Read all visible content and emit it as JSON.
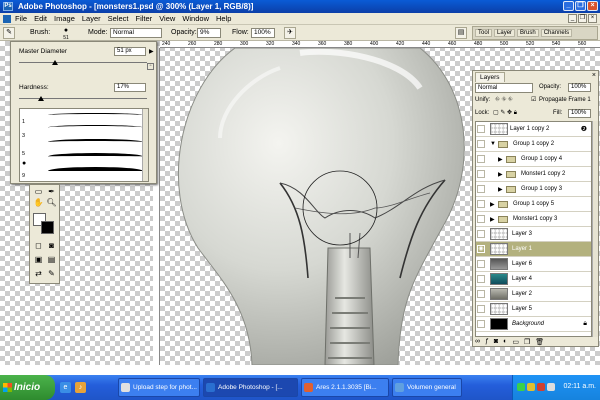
{
  "app": {
    "title": "Adobe Photoshop - [monsters1.psd @ 300% (Layer 1, RGB/8)]"
  },
  "menu": [
    "File",
    "Edit",
    "Image",
    "Layer",
    "Select",
    "Filter",
    "View",
    "Window",
    "Help"
  ],
  "options": {
    "brush_label": "Brush:",
    "brush_size": "51",
    "mode_label": "Mode:",
    "mode_value": "Normal",
    "opacity_label": "Opacity:",
    "opacity_value": "9%",
    "flow_label": "Flow:",
    "flow_value": "100%"
  },
  "wells": [
    "Tool",
    "Layer",
    "Brush",
    "Channels"
  ],
  "ruler": [
    "240",
    "260",
    "280",
    "300",
    "320",
    "340",
    "360",
    "380",
    "400",
    "420",
    "440",
    "460",
    "480",
    "500",
    "520",
    "540",
    "560"
  ],
  "brush_panel": {
    "diameter_label": "Master Diameter",
    "diameter_value": "51 px",
    "diameter_level": 0.28,
    "hardness_label": "Hardness:",
    "hardness_value": "17%",
    "hardness_level": 0.17,
    "brush_numbers": [
      "1",
      "3",
      "5",
      "9"
    ]
  },
  "layers_panel": {
    "tab": "Layers",
    "blend_mode": "Normal",
    "opacity_label": "Opacity:",
    "opacity_value": "100%",
    "unify_label": "Unify:",
    "propagate_label": "Propagate Frame 1",
    "lock_label": "Lock:",
    "fill_label": "Fill:",
    "fill_value": "100%",
    "rows": [
      {
        "name": "Layer 1 copy 2",
        "type": "layer"
      },
      {
        "name": "Group 1 copy 2",
        "type": "group-open"
      },
      {
        "name": "Group 1 copy 4",
        "type": "subgroup"
      },
      {
        "name": "Monster1 copy 2",
        "type": "subgroup"
      },
      {
        "name": "Group 1 copy 3",
        "type": "subgroup"
      },
      {
        "name": "Group 1 copy 5",
        "type": "group"
      },
      {
        "name": "Monster1 copy 3",
        "type": "group"
      },
      {
        "name": "Layer 3",
        "type": "layer"
      },
      {
        "name": "Layer 1",
        "type": "layer-selected"
      },
      {
        "name": "Layer 6",
        "type": "layer"
      },
      {
        "name": "Layer 4",
        "type": "layer"
      },
      {
        "name": "Layer 2",
        "type": "layer"
      },
      {
        "name": "Layer 5",
        "type": "layer"
      },
      {
        "name": "Background",
        "type": "background"
      }
    ]
  },
  "taskbar": {
    "start": "Inicio",
    "tasks": [
      "Upload step for phot...",
      "Adobe Photoshop - [...",
      "Ares 2.1.1.3035 [Bi...",
      "Volumen general"
    ],
    "clock": "02:11 a.m."
  },
  "colors": {
    "selected_layer": "#b3b17e",
    "titlebar": "#0b3fa8"
  }
}
